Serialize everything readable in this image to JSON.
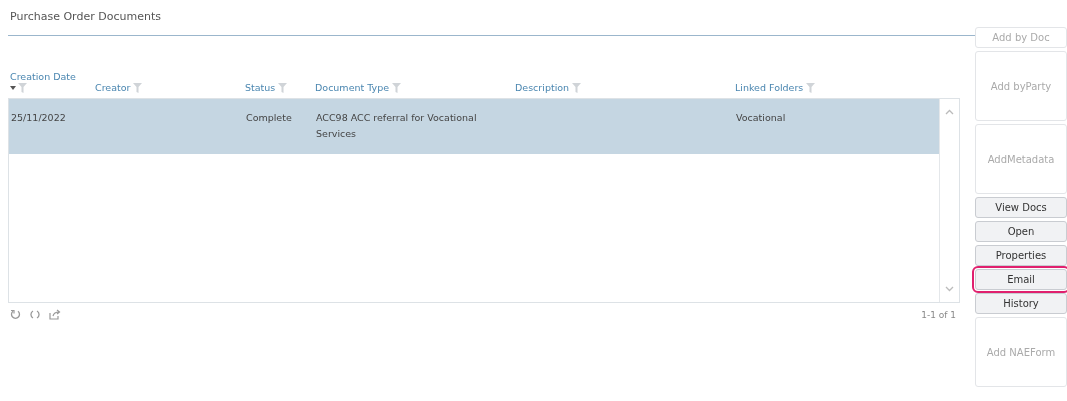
{
  "panel": {
    "title": "Purchase Order Documents"
  },
  "table": {
    "columns": [
      {
        "label": "Creation Date",
        "sorted": true
      },
      {
        "label": "Creator",
        "sorted": false
      },
      {
        "label": "Status",
        "sorted": false
      },
      {
        "label": "Document Type",
        "sorted": false
      },
      {
        "label": "Description",
        "sorted": false
      },
      {
        "label": "Linked Folders",
        "sorted": false
      }
    ],
    "rows": [
      {
        "selected": true,
        "cells": [
          "25/11/2022",
          "",
          "Complete",
          "ACC98 ACC referral for Vocational Services",
          "",
          "Vocational"
        ]
      }
    ],
    "pager": "1-1 of 1"
  },
  "buttons": [
    {
      "label": "Add by Doc",
      "disabled": true,
      "kind": "short",
      "highlighted": false
    },
    {
      "label": "Add byParty",
      "disabled": true,
      "kind": "tall",
      "highlighted": false
    },
    {
      "label": "AddMetadata",
      "disabled": true,
      "kind": "tall",
      "highlighted": false
    },
    {
      "label": "View Docs",
      "disabled": false,
      "kind": "short",
      "highlighted": false
    },
    {
      "label": "Open",
      "disabled": false,
      "kind": "short",
      "highlighted": false
    },
    {
      "label": "Properties",
      "disabled": false,
      "kind": "short",
      "highlighted": false
    },
    {
      "label": "Email",
      "disabled": false,
      "kind": "short",
      "highlighted": true
    },
    {
      "label": "History",
      "disabled": false,
      "kind": "short",
      "highlighted": false
    },
    {
      "label": "Add NAEForm",
      "disabled": true,
      "kind": "tall",
      "highlighted": false
    }
  ]
}
